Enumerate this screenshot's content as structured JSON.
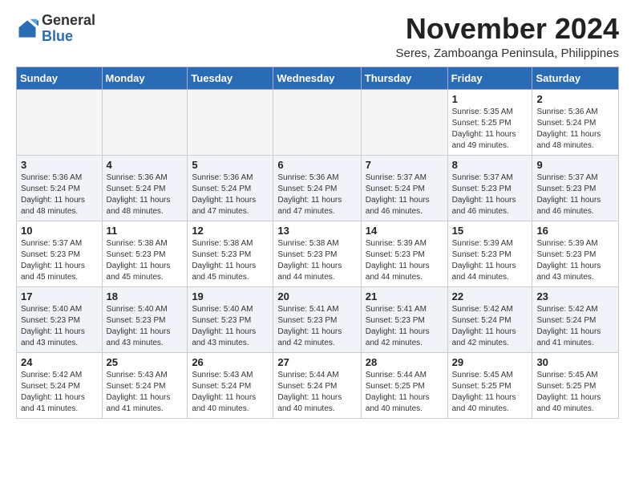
{
  "header": {
    "logo_general": "General",
    "logo_blue": "Blue",
    "month_title": "November 2024",
    "subtitle": "Seres, Zamboanga Peninsula, Philippines"
  },
  "days_of_week": [
    "Sunday",
    "Monday",
    "Tuesday",
    "Wednesday",
    "Thursday",
    "Friday",
    "Saturday"
  ],
  "weeks": [
    {
      "shaded": false,
      "days": [
        {
          "date": "",
          "info": ""
        },
        {
          "date": "",
          "info": ""
        },
        {
          "date": "",
          "info": ""
        },
        {
          "date": "",
          "info": ""
        },
        {
          "date": "",
          "info": ""
        },
        {
          "date": "1",
          "info": "Sunrise: 5:35 AM\nSunset: 5:25 PM\nDaylight: 11 hours\nand 49 minutes."
        },
        {
          "date": "2",
          "info": "Sunrise: 5:36 AM\nSunset: 5:24 PM\nDaylight: 11 hours\nand 48 minutes."
        }
      ]
    },
    {
      "shaded": true,
      "days": [
        {
          "date": "3",
          "info": "Sunrise: 5:36 AM\nSunset: 5:24 PM\nDaylight: 11 hours\nand 48 minutes."
        },
        {
          "date": "4",
          "info": "Sunrise: 5:36 AM\nSunset: 5:24 PM\nDaylight: 11 hours\nand 48 minutes."
        },
        {
          "date": "5",
          "info": "Sunrise: 5:36 AM\nSunset: 5:24 PM\nDaylight: 11 hours\nand 47 minutes."
        },
        {
          "date": "6",
          "info": "Sunrise: 5:36 AM\nSunset: 5:24 PM\nDaylight: 11 hours\nand 47 minutes."
        },
        {
          "date": "7",
          "info": "Sunrise: 5:37 AM\nSunset: 5:24 PM\nDaylight: 11 hours\nand 46 minutes."
        },
        {
          "date": "8",
          "info": "Sunrise: 5:37 AM\nSunset: 5:23 PM\nDaylight: 11 hours\nand 46 minutes."
        },
        {
          "date": "9",
          "info": "Sunrise: 5:37 AM\nSunset: 5:23 PM\nDaylight: 11 hours\nand 46 minutes."
        }
      ]
    },
    {
      "shaded": false,
      "days": [
        {
          "date": "10",
          "info": "Sunrise: 5:37 AM\nSunset: 5:23 PM\nDaylight: 11 hours\nand 45 minutes."
        },
        {
          "date": "11",
          "info": "Sunrise: 5:38 AM\nSunset: 5:23 PM\nDaylight: 11 hours\nand 45 minutes."
        },
        {
          "date": "12",
          "info": "Sunrise: 5:38 AM\nSunset: 5:23 PM\nDaylight: 11 hours\nand 45 minutes."
        },
        {
          "date": "13",
          "info": "Sunrise: 5:38 AM\nSunset: 5:23 PM\nDaylight: 11 hours\nand 44 minutes."
        },
        {
          "date": "14",
          "info": "Sunrise: 5:39 AM\nSunset: 5:23 PM\nDaylight: 11 hours\nand 44 minutes."
        },
        {
          "date": "15",
          "info": "Sunrise: 5:39 AM\nSunset: 5:23 PM\nDaylight: 11 hours\nand 44 minutes."
        },
        {
          "date": "16",
          "info": "Sunrise: 5:39 AM\nSunset: 5:23 PM\nDaylight: 11 hours\nand 43 minutes."
        }
      ]
    },
    {
      "shaded": true,
      "days": [
        {
          "date": "17",
          "info": "Sunrise: 5:40 AM\nSunset: 5:23 PM\nDaylight: 11 hours\nand 43 minutes."
        },
        {
          "date": "18",
          "info": "Sunrise: 5:40 AM\nSunset: 5:23 PM\nDaylight: 11 hours\nand 43 minutes."
        },
        {
          "date": "19",
          "info": "Sunrise: 5:40 AM\nSunset: 5:23 PM\nDaylight: 11 hours\nand 43 minutes."
        },
        {
          "date": "20",
          "info": "Sunrise: 5:41 AM\nSunset: 5:23 PM\nDaylight: 11 hours\nand 42 minutes."
        },
        {
          "date": "21",
          "info": "Sunrise: 5:41 AM\nSunset: 5:23 PM\nDaylight: 11 hours\nand 42 minutes."
        },
        {
          "date": "22",
          "info": "Sunrise: 5:42 AM\nSunset: 5:24 PM\nDaylight: 11 hours\nand 42 minutes."
        },
        {
          "date": "23",
          "info": "Sunrise: 5:42 AM\nSunset: 5:24 PM\nDaylight: 11 hours\nand 41 minutes."
        }
      ]
    },
    {
      "shaded": false,
      "days": [
        {
          "date": "24",
          "info": "Sunrise: 5:42 AM\nSunset: 5:24 PM\nDaylight: 11 hours\nand 41 minutes."
        },
        {
          "date": "25",
          "info": "Sunrise: 5:43 AM\nSunset: 5:24 PM\nDaylight: 11 hours\nand 41 minutes."
        },
        {
          "date": "26",
          "info": "Sunrise: 5:43 AM\nSunset: 5:24 PM\nDaylight: 11 hours\nand 40 minutes."
        },
        {
          "date": "27",
          "info": "Sunrise: 5:44 AM\nSunset: 5:24 PM\nDaylight: 11 hours\nand 40 minutes."
        },
        {
          "date": "28",
          "info": "Sunrise: 5:44 AM\nSunset: 5:25 PM\nDaylight: 11 hours\nand 40 minutes."
        },
        {
          "date": "29",
          "info": "Sunrise: 5:45 AM\nSunset: 5:25 PM\nDaylight: 11 hours\nand 40 minutes."
        },
        {
          "date": "30",
          "info": "Sunrise: 5:45 AM\nSunset: 5:25 PM\nDaylight: 11 hours\nand 40 minutes."
        }
      ]
    }
  ]
}
